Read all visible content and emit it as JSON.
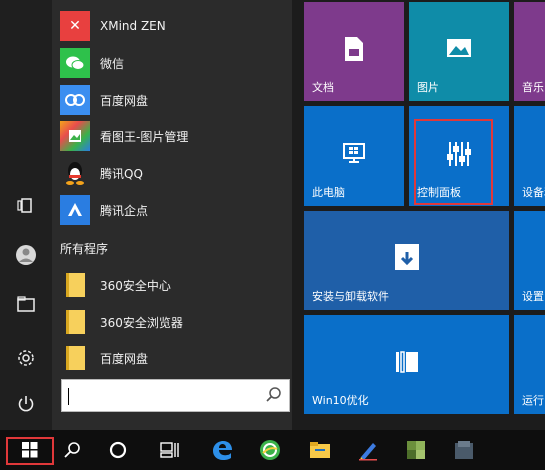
{
  "apps_recent": [
    {
      "label": "XMind ZEN",
      "icon": "xmind-icon",
      "color": "#e8403f"
    },
    {
      "label": "微信",
      "icon": "wechat-icon",
      "color": "#2ec14b"
    },
    {
      "label": "百度网盘",
      "icon": "baidu-netdisk-icon",
      "color": "#3b8ef0"
    },
    {
      "label": "看图王-图片管理",
      "icon": "picture-manager-icon",
      "color": "#f4a31b"
    },
    {
      "label": "腾讯QQ",
      "icon": "qq-icon",
      "color": "#2b2b2b"
    },
    {
      "label": "腾讯企点",
      "icon": "tencent-qidian-icon",
      "color": "#2a7de1"
    }
  ],
  "all_programs_label": "所有程序",
  "apps_all": [
    {
      "label": "360安全中心"
    },
    {
      "label": "360安全浏览器"
    },
    {
      "label": "百度网盘"
    }
  ],
  "search": {
    "value": "",
    "placeholder": ""
  },
  "tiles": {
    "documents": {
      "label": "文档",
      "color": "#7e3a8c"
    },
    "pictures": {
      "label": "图片",
      "color": "#0f8ca8"
    },
    "music": {
      "label": "音乐",
      "color": "#7e3a8c"
    },
    "this_pc": {
      "label": "此电脑",
      "color": "#0a6fc9"
    },
    "control_panel": {
      "label": "控制面板",
      "color": "#0a6fc9"
    },
    "devices": {
      "label": "设备和",
      "color": "#0a6fc9"
    },
    "programs": {
      "label": "安装与卸载软件",
      "color": "#1f5fa8"
    },
    "settings": {
      "label": "设置",
      "color": "#0a6fc9"
    },
    "win10opt": {
      "label": "Win10优化",
      "color": "#0a6fc9"
    },
    "run": {
      "label": "运行",
      "color": "#0a6fc9"
    }
  },
  "taskbar": {
    "items": [
      "start-icon",
      "search-icon",
      "cortana-icon",
      "task-view-icon",
      "edge-icon",
      "browser-360-icon",
      "file-explorer-icon",
      "pen-app-icon",
      "app-icon",
      "app-icon"
    ]
  },
  "highlight_color": "#e0383a"
}
